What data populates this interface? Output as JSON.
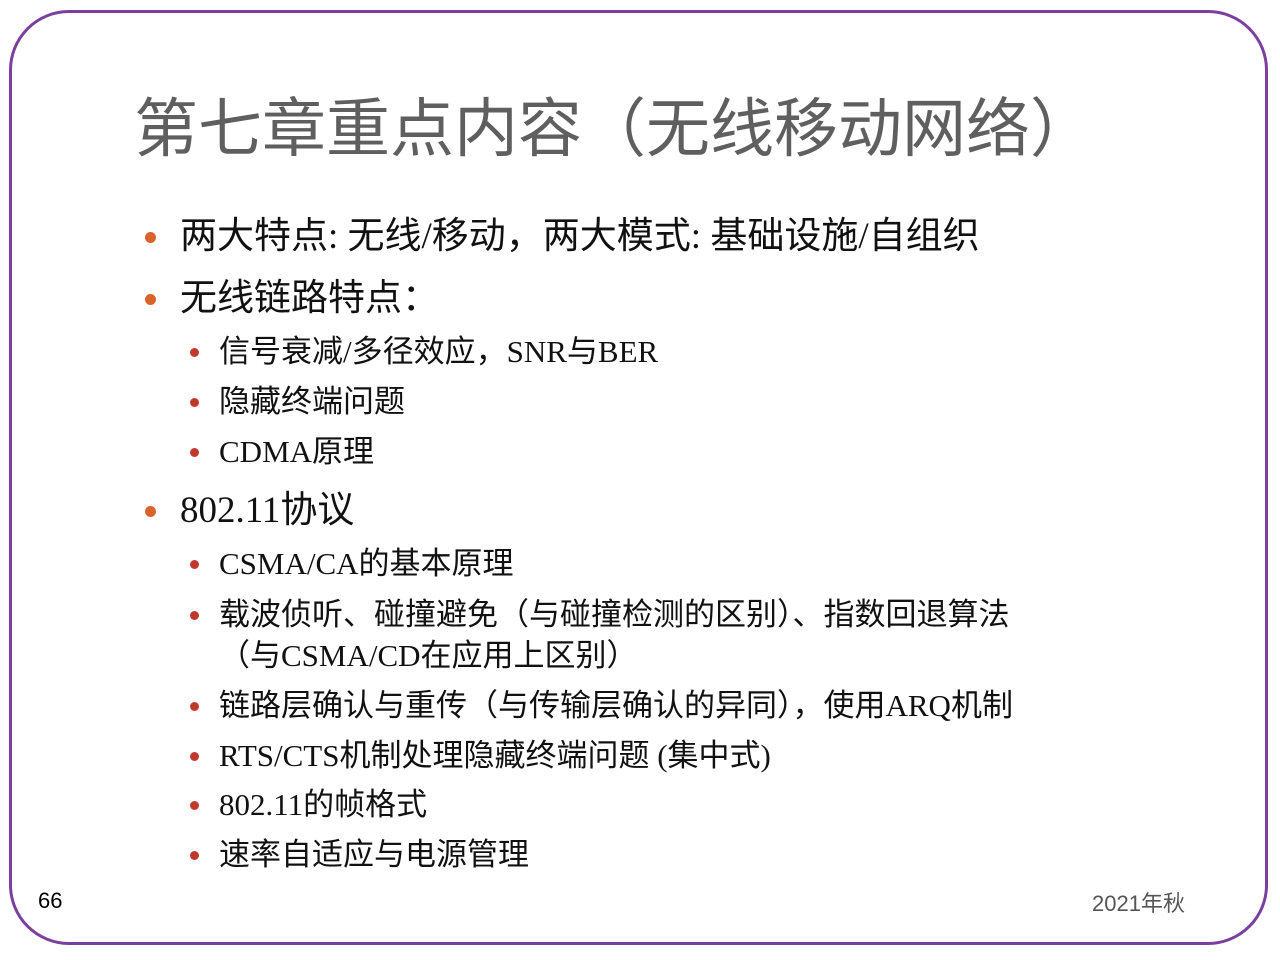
{
  "title": "第七章重点内容（无线移动网络）",
  "items": [
    {
      "text": "两大特点: 无线/移动，两大模式: 基础设施/自组织"
    },
    {
      "text": "无线链路特点：",
      "children": [
        "信号衰减/多径效应，SNR与BER",
        "隐藏终端问题",
        "CDMA原理"
      ]
    },
    {
      "text": "802.11协议",
      "children": [
        "CSMA/CA的基本原理",
        "载波侦听、碰撞避免（与碰撞检测的区别）、指数回退算法",
        "（与CSMA/CD在应用上区别）",
        "链路层确认与重传（与传输层确认的异同），使用ARQ机制",
        "RTS/CTS机制处理隐藏终端问题 (集中式)",
        "802.11的帧格式",
        "速率自适应与电源管理"
      ]
    }
  ],
  "footer": {
    "page_number": "66",
    "term": "2021年秋"
  },
  "colors": {
    "border": "#7b3fa0",
    "bullet_level1": "#d9632a",
    "bullet_level2": "#c0392b",
    "title": "#5f5f5f"
  }
}
